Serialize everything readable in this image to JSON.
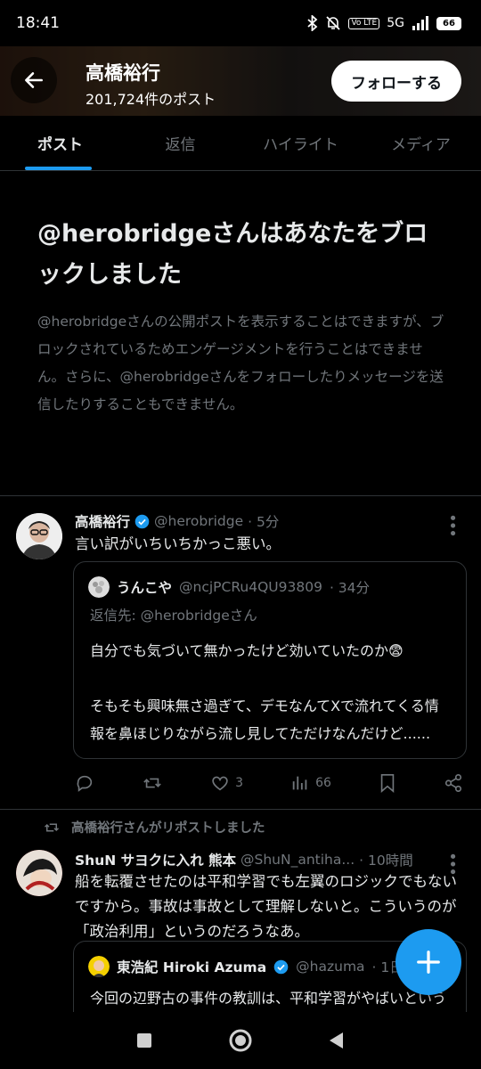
{
  "status_bar": {
    "time": "18:41",
    "network": "5G",
    "volte": "Vo LTE",
    "battery": "66"
  },
  "header": {
    "title": "高橋裕行",
    "post_count": "201,724件のポスト",
    "follow_label": "フォローする"
  },
  "tabs": [
    {
      "label": "ポスト"
    },
    {
      "label": "返信"
    },
    {
      "label": "ハイライト"
    },
    {
      "label": "メディア"
    }
  ],
  "block_notice": {
    "title": "@herobridgeさんはあなたをブロックしました",
    "body": "@herobridgeさんの公開ポストを表示することはできますが、ブロックされているためエンゲージメントを行うことはできません。さらに、@herobridgeさんをフォローしたりメッセージを送信したりすることもできません。"
  },
  "post1": {
    "name": "高橋裕行",
    "handle": "@herobridge",
    "time": "· 5分",
    "text": "言い訳がいちいちかっこ悪い。",
    "quote": {
      "name": "うんこや",
      "handle": "@ncjPCRu4QU93809",
      "time": "· 34分",
      "reply_to": "返信先: @herobridgeさん",
      "body": "自分でも気づいて無かったけど効いていたのか😨\n\nそもそも興味無さ過ぎて、デモなんてXで流れてくる情報を鼻ほじりながら流し見してただけなんだけど......"
    },
    "likes": "3",
    "views": "66"
  },
  "repost_label": "高橋裕行さんがリポストしました",
  "post2": {
    "name": "ShuN サヨクに入れ 熊本",
    "handle": "@ShuN_antiha...",
    "time": "· 10時間",
    "text": "船を転覆させたのは平和学習でも左翼のロジックでもないですから。事故は事故として理解しないと。こういうのが「政治利用」というのだろうなあ。",
    "quote": {
      "name": "東浩紀 Hiroki Azuma",
      "handle": "@hazuma",
      "time": "· 1日",
      "body": "今回の辺野古の事件の教訓は、平和学習がやばいという話ではなく、平和学習をやると"
    }
  },
  "colors": {
    "accent": "#1d9bf0",
    "background": "#000000",
    "text": "#e7e9ea",
    "muted": "#71767b",
    "border": "#2f3336"
  }
}
